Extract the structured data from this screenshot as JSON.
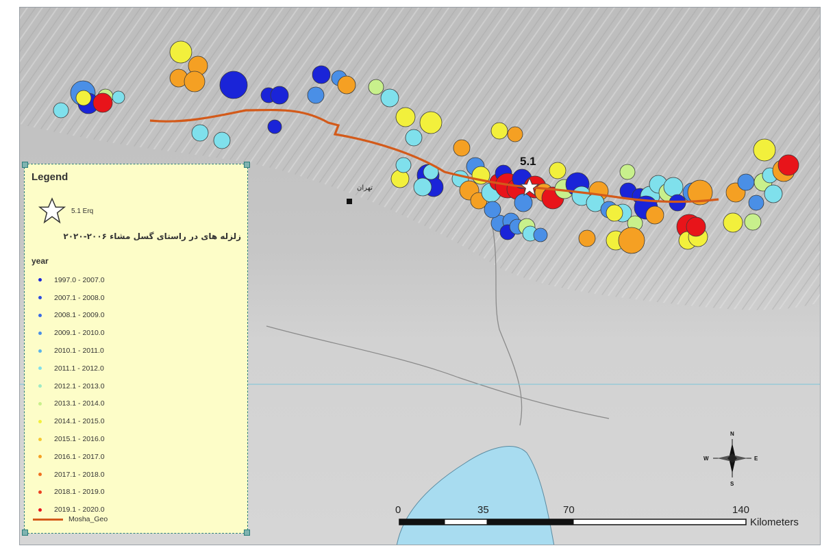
{
  "legend": {
    "title": "Legend",
    "star_label": "5.1 Erq",
    "subtitle": "زلزله های در راستای گسل مشاء ۲۰۰۶-۲۰۲۰",
    "year_header": "year",
    "year_ranges": [
      "1997.0 - 2007.0",
      "2007.1 - 2008.0",
      "2008.1 - 2009.0",
      "2009.1 - 2010.0",
      "2010.1 - 2011.0",
      "2011.1 - 2012.0",
      "2012.1 - 2013.0",
      "2013.1 - 2014.0",
      "2014.1 - 2015.0",
      "2015.1 - 2016.0",
      "2016.1 - 2017.0",
      "2017.1 - 2018.0",
      "2018.1 - 2019.0",
      "2019.1 - 2020.0"
    ],
    "fault_label": "Mosha_Geo"
  },
  "map": {
    "epicenter_magnitude": "5.1",
    "city_label": "تهران",
    "north_label": "N",
    "south_label": "S",
    "east_label": "E",
    "west_label": "W"
  },
  "scale_bar": {
    "ticks": [
      "0",
      "35",
      "70",
      "140"
    ],
    "unit": "Kilometers"
  },
  "colors": {
    "fault": "#d35a1a",
    "blue": "#1a24d8",
    "mid_blue": "#4a8fe6",
    "cyan": "#7fe0ec",
    "light_green": "#c8f08c",
    "yellow": "#f2f03c",
    "orange": "#f5a023",
    "red": "#e8141a",
    "lake": "#a8dcf0"
  }
}
